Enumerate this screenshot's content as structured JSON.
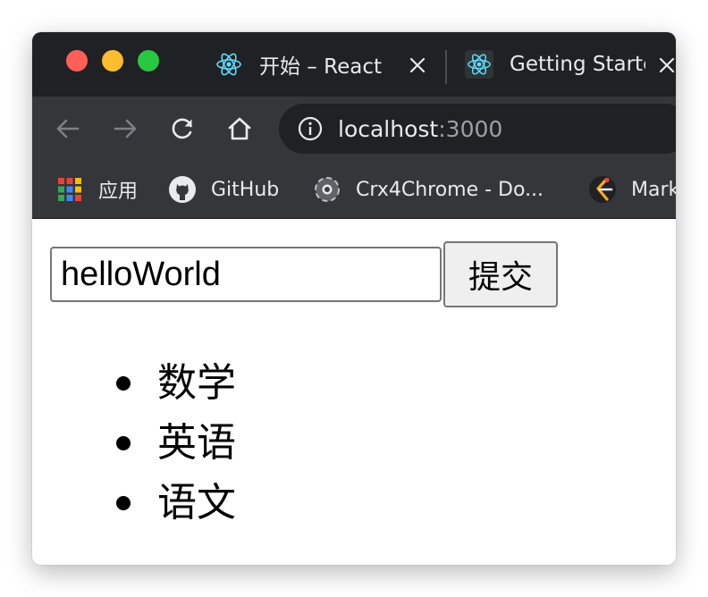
{
  "browser": {
    "tabs": [
      {
        "title": "开始 – React",
        "icon": "react-icon",
        "close": "✕"
      },
      {
        "title": "Getting Started",
        "icon": "react-icon",
        "close": "✕"
      }
    ],
    "nav": {
      "back": "back-arrow-icon",
      "forward": "forward-arrow-icon",
      "reload": "reload-icon",
      "home": "home-icon"
    },
    "address": {
      "host": "localhost",
      "port": ":3000",
      "icon": "info-icon"
    },
    "bookmarks": [
      {
        "label": "应用",
        "icon": "apps-grid-icon"
      },
      {
        "label": "GitHub",
        "icon": "github-icon"
      },
      {
        "label": "Crx4Chrome - Do...",
        "icon": "crx4chrome-icon"
      },
      {
        "label": "Mark",
        "icon": "bookmark-app-icon"
      }
    ],
    "colors": {
      "titlebar": "#202124",
      "toolbar": "#35363a",
      "react": "#61dafb"
    }
  },
  "page": {
    "input": {
      "value": "helloWorld",
      "placeholder": ""
    },
    "submit_label": "提交",
    "items": [
      "数学",
      "英语",
      "语文"
    ]
  }
}
